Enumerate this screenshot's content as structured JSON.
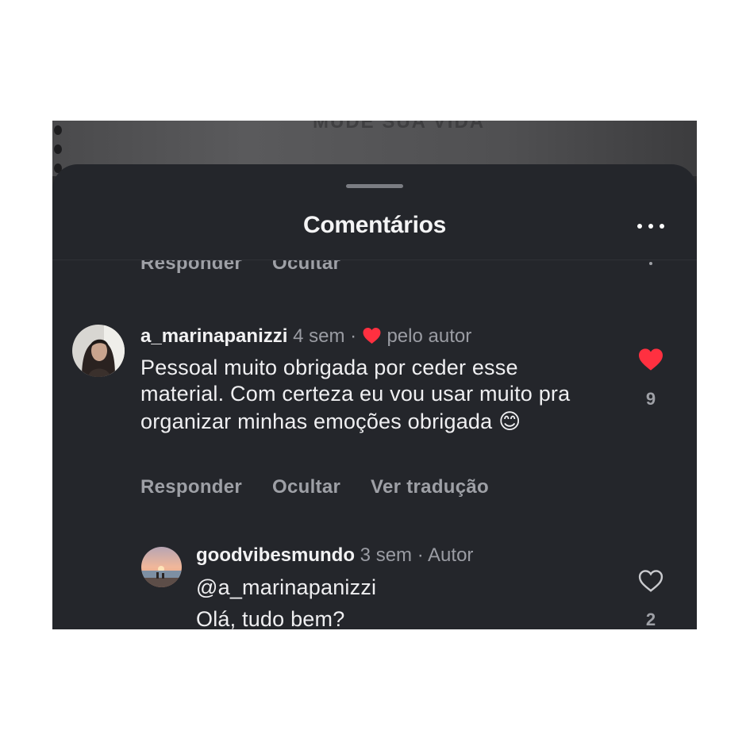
{
  "background": {
    "header_text": "MUDE SUA VIDA"
  },
  "sheet": {
    "title": "Comentários",
    "more_icon": "more-horizontal-icon"
  },
  "prev_comment": {
    "reply_label": "Responder",
    "hide_label": "Ocultar"
  },
  "comments": [
    {
      "username": "a_marinapanizzi",
      "time": "4 sem",
      "separator": "·",
      "liked_by_author_label": "pelo autor",
      "text": "Pessoal muito obrigada por ceder esse material. Com certeza eu vou usar muito pra organizar minhas emoções obrigada",
      "emoji": "😊",
      "likes": "9",
      "liked": true,
      "actions": {
        "reply": "Responder",
        "hide": "Ocultar",
        "translate": "Ver tradução"
      }
    },
    {
      "username": "goodvibesmundo",
      "time": "3 sem",
      "separator": "·",
      "author_badge": "Autor",
      "mention": "@a_marinapanizzi",
      "text": "Olá, tudo bem?",
      "likes": "2",
      "liked": false
    }
  ],
  "colors": {
    "sheet_bg": "#24262b",
    "like_red": "#ff3040",
    "muted_text": "#9ea0a6"
  }
}
